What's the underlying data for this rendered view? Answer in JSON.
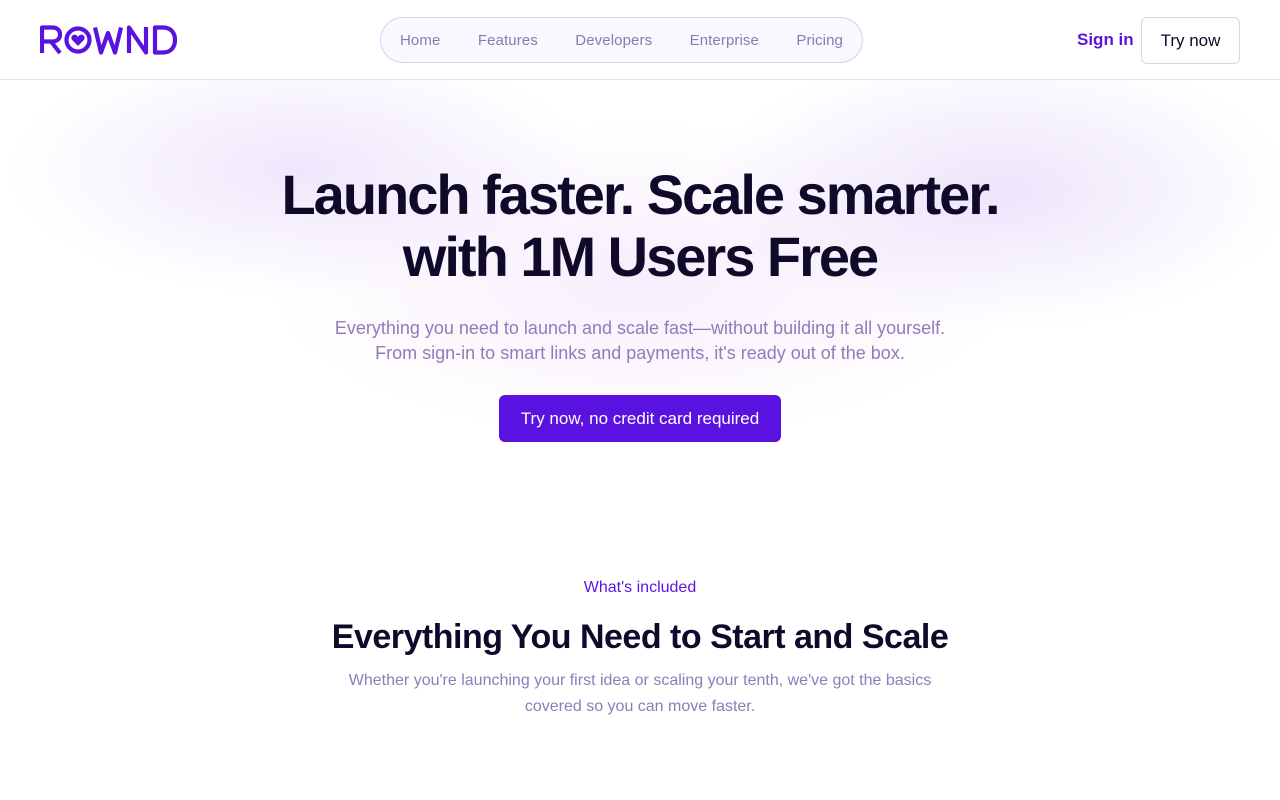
{
  "brand": {
    "logo_text": "ROWND",
    "accent": "#5a12e0"
  },
  "nav": {
    "items": [
      {
        "label": "Home"
      },
      {
        "label": "Features"
      },
      {
        "label": "Developers"
      },
      {
        "label": "Enterprise"
      },
      {
        "label": "Pricing"
      }
    ]
  },
  "header": {
    "signin_label": "Sign in",
    "trynow_label": "Try now"
  },
  "hero": {
    "headline_line1": "Launch faster. Scale smarter.",
    "headline_line2": "with 1M Users Free",
    "sub_line1": "Everything you need to launch and scale fast—without building it all yourself.",
    "sub_line2": "From sign-in to smart links and payments, it's ready out of the box.",
    "cta_label": "Try now, no credit card required"
  },
  "features": {
    "eyebrow": "What's included",
    "title": "Everything You Need to Start and Scale",
    "sub_line1": "Whether you're launching your first idea or scaling your tenth, we've got the basics",
    "sub_line2": "covered so you can move faster."
  }
}
